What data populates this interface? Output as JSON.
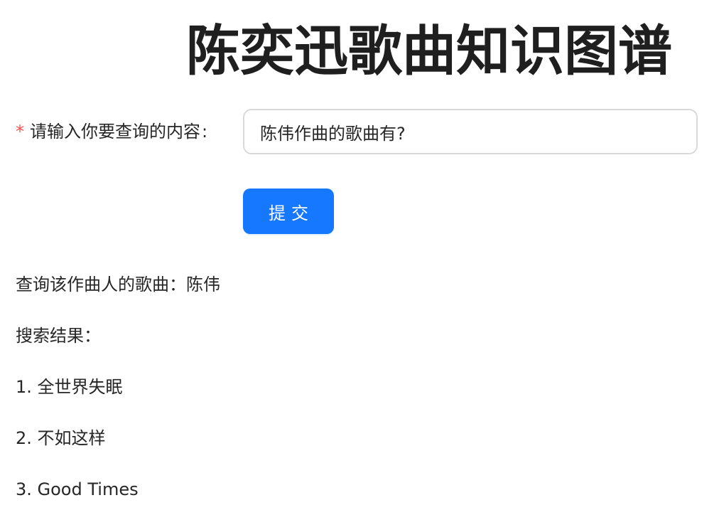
{
  "page": {
    "title": "陈奕迅歌曲知识图谱"
  },
  "form": {
    "required_mark": "*",
    "label": "请输入你要查询的内容",
    "label_colon": ":",
    "input_value": "陈伟作曲的歌曲有?",
    "submit_label": "提交"
  },
  "results": {
    "query_summary": "查询该作曲人的歌曲：陈伟",
    "heading": "搜索结果：",
    "items": [
      "1. 全世界失眠",
      "2. 不如这样",
      "3. Good Times"
    ]
  },
  "colors": {
    "accent": "#1677ff",
    "required": "#ff4d4f",
    "text": "#262626",
    "border": "#d9d9d9"
  }
}
